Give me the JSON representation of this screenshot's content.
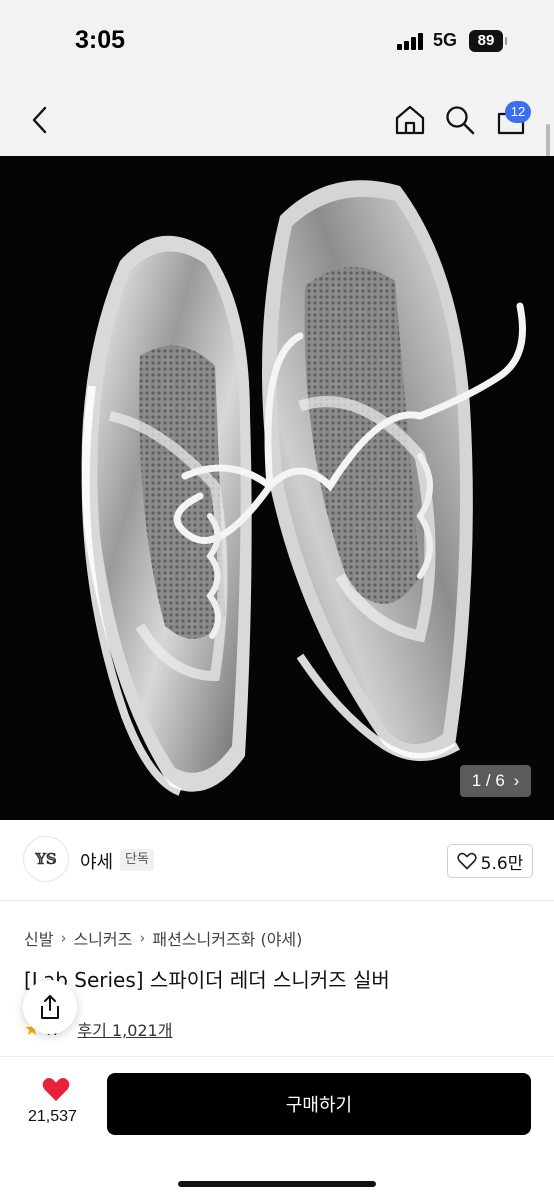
{
  "status_bar": {
    "time": "3:05",
    "network": "5G",
    "battery": "89"
  },
  "nav": {
    "cart_count": "12",
    "back_icon": "chevron-left-icon",
    "home_icon": "home-icon",
    "search_icon": "search-icon",
    "cart_icon": "cart-icon"
  },
  "gallery": {
    "counter": "1 / 6",
    "current": 1,
    "total": 6
  },
  "brand": {
    "logo_text": "𝕐𝕊",
    "name": "야세",
    "badge": "단독",
    "likes": "5.6만"
  },
  "breadcrumb": [
    "신발",
    "스니커즈",
    "패션스니커즈화 (야세)"
  ],
  "product": {
    "title": "[Lab Series] 스파이더 레더 스니커즈 실버",
    "rating": ".7",
    "reviews": "후기 1,021개"
  },
  "bottom": {
    "wish_count": "21,537",
    "buy_label": "구매하기"
  },
  "colors": {
    "accent_blue": "#3a6ff0",
    "heart_red": "#e8203a",
    "star_yellow": "#f5b100",
    "buy_black": "#000000"
  }
}
